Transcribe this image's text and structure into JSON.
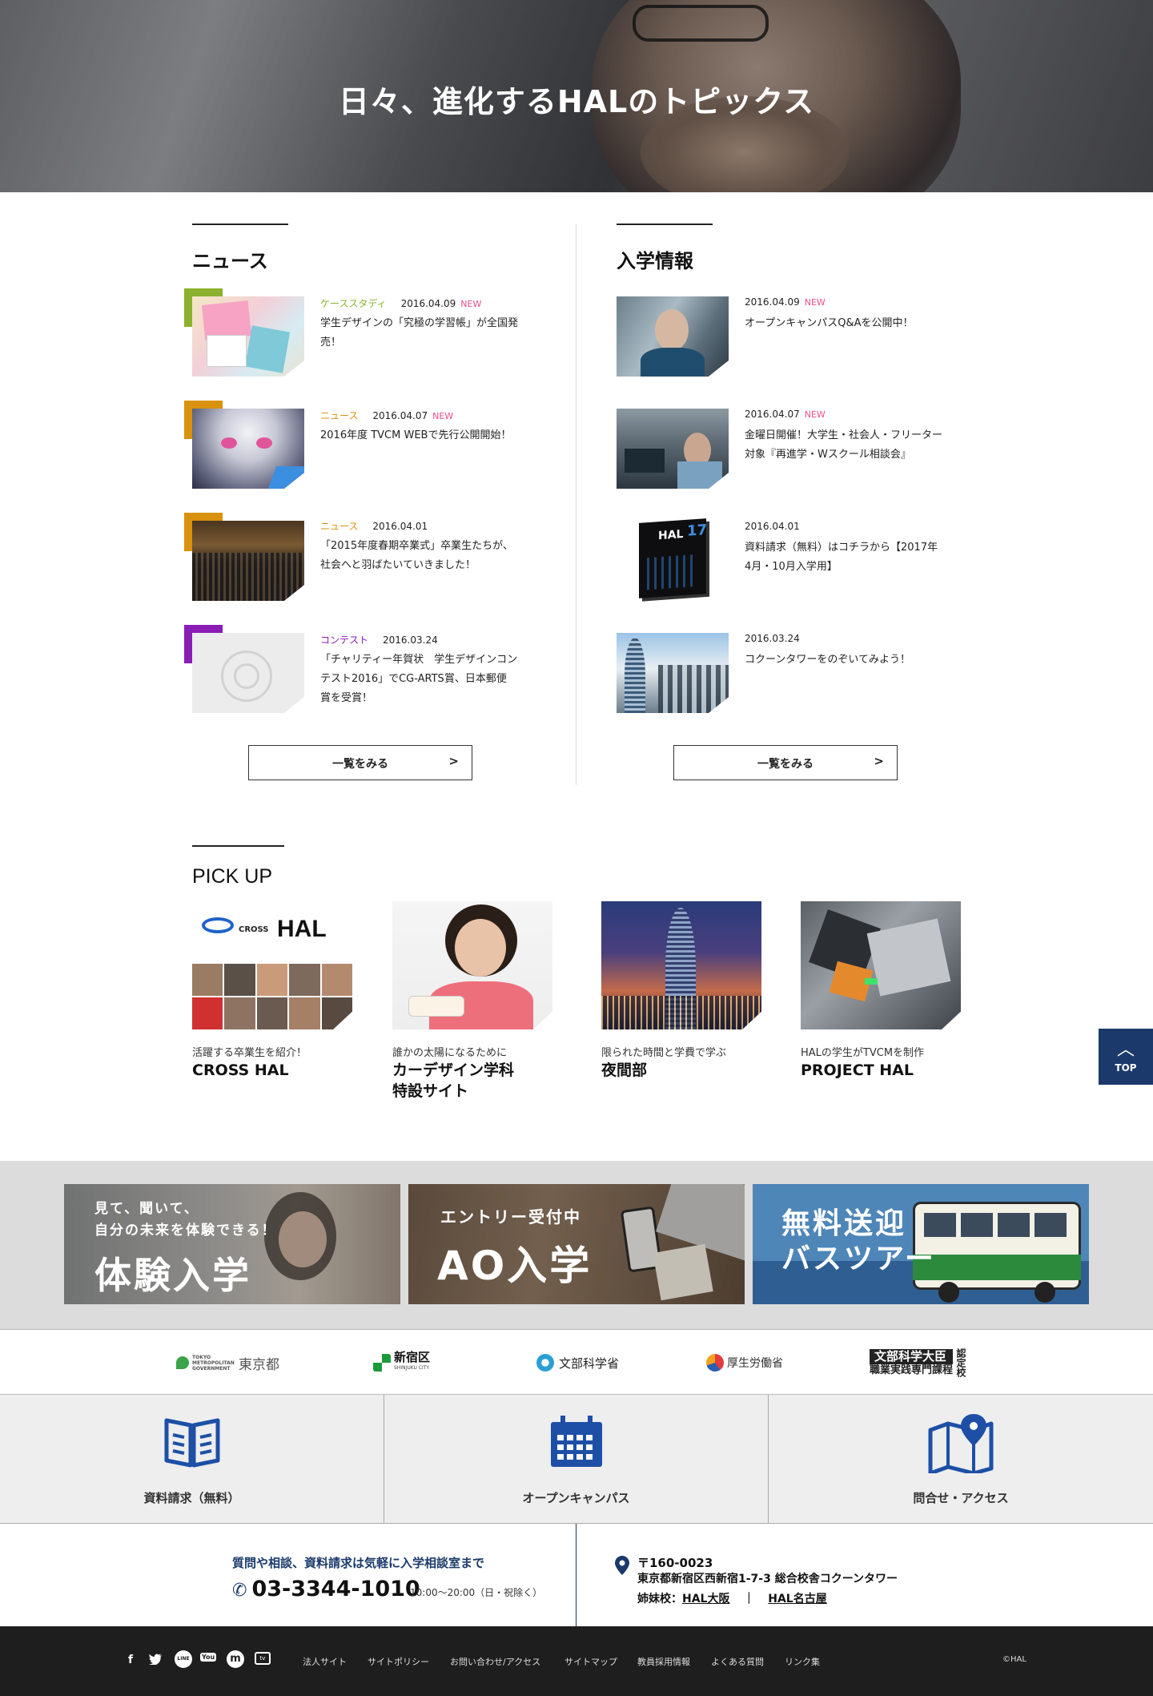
{
  "hero": {
    "title": "日々、進化するHALのトピックス"
  },
  "news": {
    "title": "ニュース",
    "items": [
      {
        "category": "ケーススタディ",
        "date": "2016.04.09",
        "new": "NEW",
        "lines": [
          "学生デザインの「究極の学習帳」が全国発",
          "売！"
        ]
      },
      {
        "category": "ニュース",
        "date": "2016.04.07",
        "new": "NEW",
        "lines": [
          "2016年度 TVCM WEBで先行公開開始！"
        ]
      },
      {
        "category": "ニュース",
        "date": "2016.04.01",
        "new": "",
        "lines": [
          "「2015年度春期卒業式」卒業生たちが、",
          "社会へと羽ばたいていきました！"
        ]
      },
      {
        "category": "コンテスト",
        "date": "2016.03.24",
        "new": "",
        "lines": [
          "「チャリティー年賀状　学生デザインコン",
          "テスト2016」でCG-ARTS賞、日本郵便",
          "賞を受賞！"
        ]
      }
    ],
    "more": "一覧をみる",
    "arrow": ">"
  },
  "admission": {
    "title": "入学情報",
    "items": [
      {
        "date": "2016.04.09",
        "new": "NEW",
        "lines": [
          "オープンキャンパスQ&Aを公開中！"
        ]
      },
      {
        "date": "2016.04.07",
        "new": "NEW",
        "lines": [
          "金曜日開催！大学生・社会人・フリーター",
          "対象『再進学・Wスクール相談会』"
        ]
      },
      {
        "date": "2016.04.01",
        "new": "",
        "lines": [
          "資料請求（無料）はコチラから【2017年",
          "4月・10月入学用】"
        ]
      },
      {
        "date": "2016.03.24",
        "new": "",
        "lines": [
          "コクーンタワーをのぞいてみよう！"
        ]
      }
    ],
    "thumb3_text": "HAL",
    "thumb3_sub": "17",
    "more": "一覧をみる",
    "arrow": ">"
  },
  "pickup": {
    "title": "PICK UP",
    "cross_logo": "CROSS",
    "cross_hal": "HAL",
    "items": [
      {
        "sub": "活躍する卒業生を紹介！",
        "title": "CROSS HAL"
      },
      {
        "sub": "誰かの太陽になるために",
        "title": "カーデザイン学科\n特設サイト"
      },
      {
        "sub": "限られた時間と学費で学ぶ",
        "title": "夜間部"
      },
      {
        "sub": "HALの学生がTVCMを制作",
        "title": "PROJECT HAL"
      }
    ]
  },
  "top_button": {
    "label": "TOP",
    "chevron": "︿"
  },
  "banners": [
    {
      "small1": "見て、聞いて、",
      "small2": "自分の未来を体験できる！",
      "big": "体験入学"
    },
    {
      "small1": "エントリー受付中",
      "big": "AO入学"
    },
    {
      "big1": "無料送迎",
      "big2": "バスツアー"
    }
  ],
  "logos": {
    "tokyo": "東京都",
    "tokyo_sub": "TOKYO METROPOLITAN GOVERNMENT",
    "shinjuku": "新宿区",
    "shinjuku_sub": "SHINJUKU CITY",
    "mext": "文部科学省",
    "mhlw": "厚生労働省",
    "cert1": "文部科学大臣",
    "cert2": "職業実践専門課程",
    "cert3": "認定校"
  },
  "actions": [
    {
      "label": "資料請求（無料）"
    },
    {
      "label": "オープンキャンパス"
    },
    {
      "label": "問合せ・アクセス"
    }
  ],
  "contact": {
    "lead": "質問や相談、資料請求は気軽に入学相談室まで",
    "tel": "03-3344-1010",
    "hours": "10:00〜20:00（日・祝除く）",
    "zip": "〒160-0023",
    "address": "東京都新宿区西新宿1-7-3 総合校舎コクーンタワー",
    "sister_label": "姉妹校：",
    "sister1": "HAL大阪",
    "sep": "｜",
    "sister2": "HAL名古屋"
  },
  "footer": {
    "social": [
      "f",
      "t",
      "LINE",
      "You",
      "m",
      "tv"
    ],
    "links": [
      "法人サイト",
      "サイトポリシー",
      "お問い合わせ/アクセス",
      "サイトマップ",
      "教員採用情報",
      "よくある質問",
      "リンク集"
    ],
    "copyright": "©HAL"
  },
  "colors": {
    "case_study": "#8bb12e",
    "news": "#d9920e",
    "contest": "#8a1db5",
    "new_badge": "#e94d8b",
    "navy": "#1b3a6b"
  }
}
